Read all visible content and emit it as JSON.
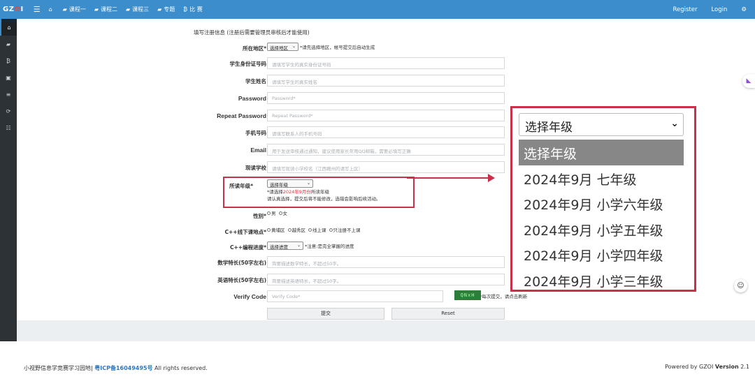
{
  "nav": {
    "brand_prefix": "GZ",
    "brand_o": "O",
    "brand_suffix": "I",
    "items": [
      {
        "label": "",
        "icon": "home-icon"
      },
      {
        "label": "课程一",
        "icon": "book-icon"
      },
      {
        "label": "课程二",
        "icon": "book-icon"
      },
      {
        "label": "课程三",
        "icon": "book-icon"
      },
      {
        "label": "专题",
        "icon": "book-icon"
      },
      {
        "label": "比 赛",
        "icon": "bitcoin-icon"
      }
    ],
    "register": "Register",
    "login": "Login"
  },
  "form": {
    "heading": "填写注册信息 (注册后需要管理员审核后才能使用)",
    "region": {
      "label": "所在地区*",
      "select": "选择地区",
      "note": "*请先选择地区，帐号提交后自动生成"
    },
    "student_id": {
      "label": "学生身份证号码",
      "placeholder": "请填写学生的真实身份证号码"
    },
    "student_name": {
      "label": "学生姓名",
      "placeholder": "请填写学生的真实姓名"
    },
    "password": {
      "label": "Password",
      "placeholder": "Password*"
    },
    "repeat_password": {
      "label": "Repeat Password",
      "placeholder": "Repeat Password*"
    },
    "phone": {
      "label": "手机号码",
      "placeholder": "请填写联系人的手机号码"
    },
    "email": {
      "label": "Email",
      "placeholder": "用于发送审核通过通知，建议使用家长常用QQ邮箱，需要必填写正确"
    },
    "school": {
      "label": "现读学校",
      "placeholder": "请填写现读小学校名（江西赣州的请写上区）"
    },
    "grade": {
      "label": "所读年级*",
      "select": "选择年级",
      "note1_prefix": "*请选择",
      "note1_red": "2024年9月份",
      "note1_suffix": "所读年级",
      "note2": "请认真选择，提交后将不能修改，选错会影响后续活动。"
    },
    "gender": {
      "label": "性别*",
      "options": [
        "男",
        "女"
      ]
    },
    "location": {
      "label": "C++线下课地点*",
      "options": [
        "黄埔区",
        "越秀区",
        "线上课",
        "只注册不上课"
      ]
    },
    "progress": {
      "label": "C++编程进度*",
      "select": "选择进度",
      "note": "*注意:是完全掌握的进度"
    },
    "math": {
      "label": "数学特长(50字左右)",
      "placeholder": "简要描述数学特长，不超过50字。"
    },
    "english": {
      "label": "英语特长(50字左右)",
      "placeholder": "简要描述英语特长，不超过50字。"
    },
    "verify": {
      "label": "Verify Code",
      "placeholder": "Verify Code*",
      "captcha": "QNxH",
      "note": "*每次提交，请点击刷新"
    },
    "submit": "提交",
    "reset": "Reset"
  },
  "zoom": {
    "selected": "选择年级",
    "options": [
      "选择年级",
      "2024年9月 七年级",
      "2024年9月 小学六年级",
      "2024年9月 小学五年级",
      "2024年9月 小学四年级",
      "2024年9月 小学三年级"
    ]
  },
  "footer": {
    "text1": "小视野信息学竞赛学习园地|",
    "icp": "粤ICP备16049495号",
    "text2": "All rights reserved.",
    "powered": "Powered by GZOI",
    "version_label": "Version",
    "version": "2.1"
  },
  "colors": {
    "nav": "#3c8dcb",
    "highlight": "#c8314a",
    "sidebar": "#2d3236"
  }
}
